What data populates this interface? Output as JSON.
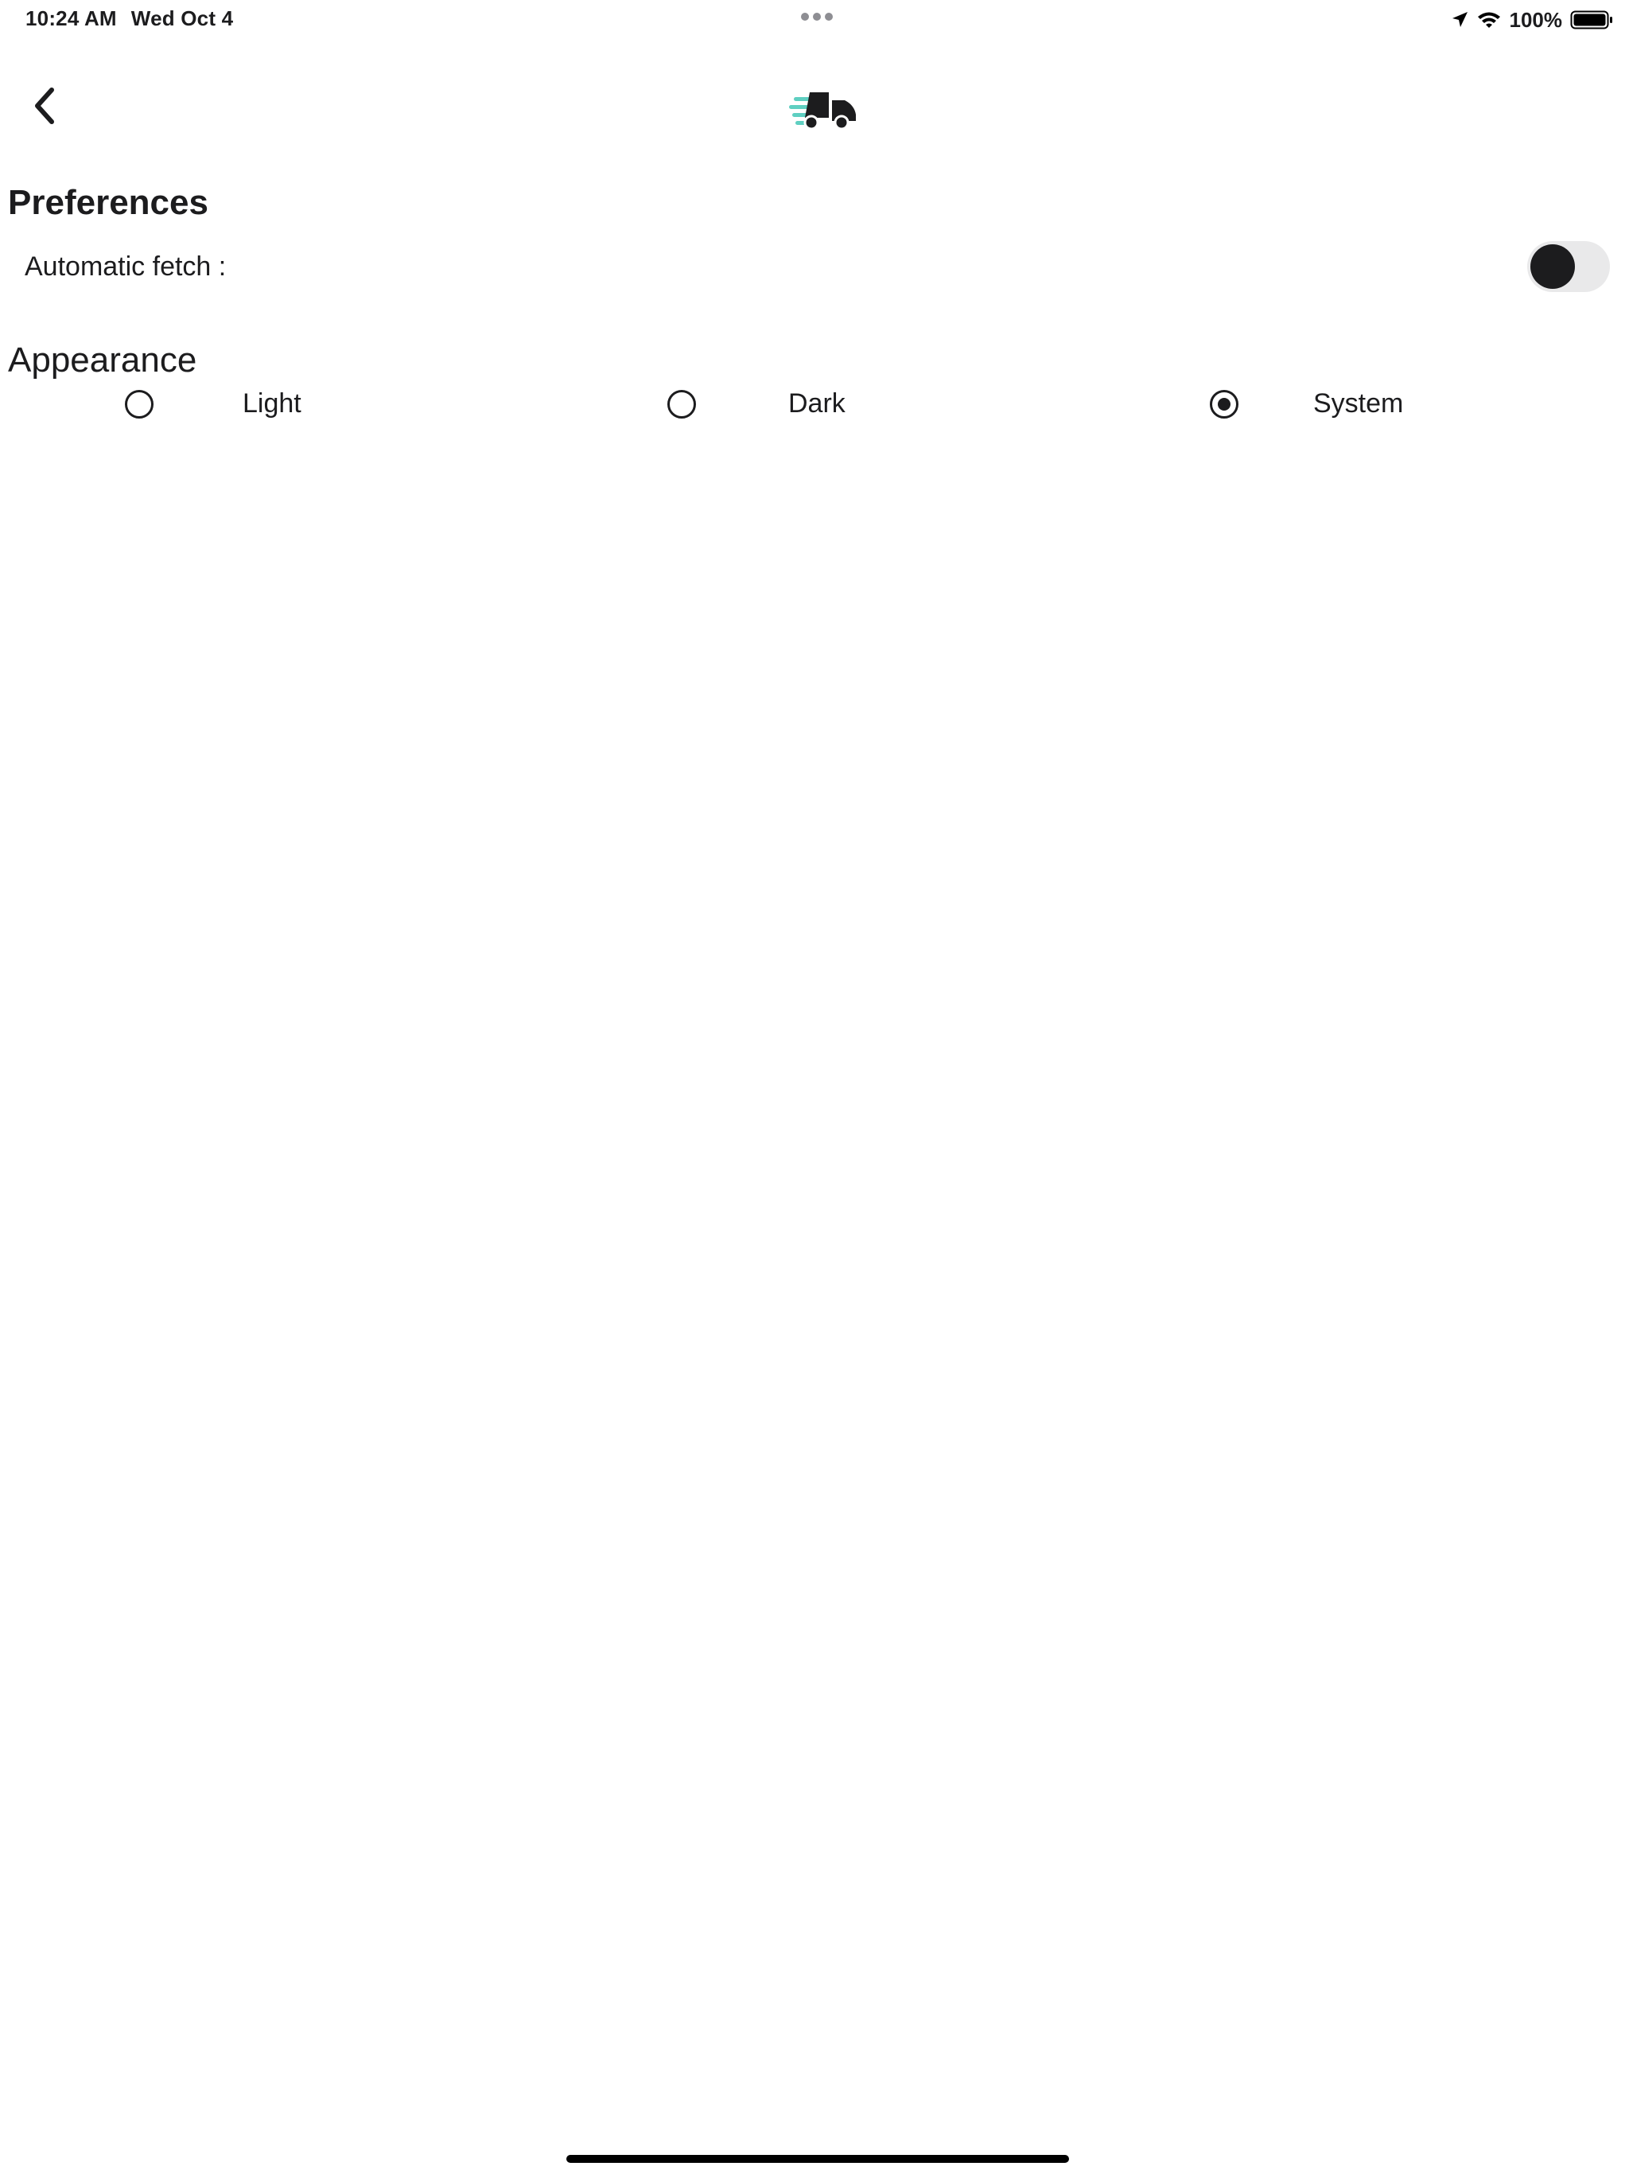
{
  "status_bar": {
    "time": "10:24 AM",
    "date": "Wed Oct 4",
    "battery": "100%",
    "icons": [
      "location-icon",
      "wifi-icon",
      "battery-icon"
    ]
  },
  "header": {
    "back_icon": "chevron-left-icon",
    "logo_icon": "delivery-truck-icon"
  },
  "preferences": {
    "title": "Preferences",
    "automatic_fetch_label": "Automatic fetch :",
    "automatic_fetch_enabled": false
  },
  "appearance": {
    "title": "Appearance",
    "options": [
      {
        "label": "Light",
        "selected": false
      },
      {
        "label": "Dark",
        "selected": false
      },
      {
        "label": "System",
        "selected": true
      }
    ]
  },
  "colors": {
    "text": "#1c1c1e",
    "toggle_track": "#e9e9ea",
    "logo_accent": "#5fcfc1",
    "background": "#ffffff"
  }
}
